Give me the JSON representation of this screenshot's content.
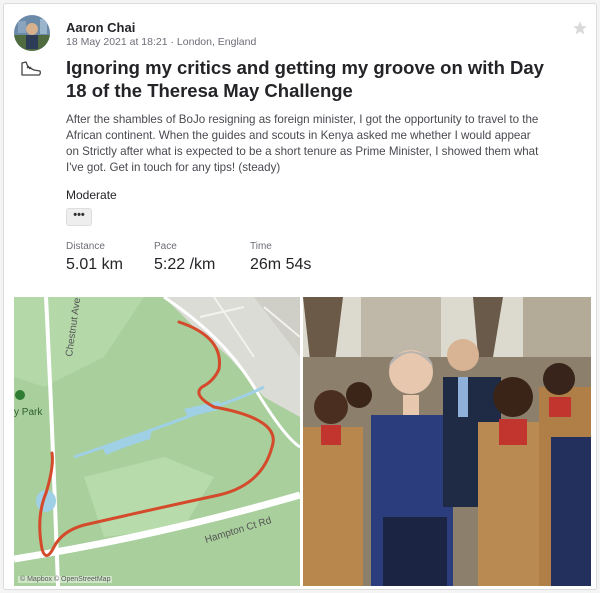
{
  "activity": {
    "athlete_name": "Aaron Chai",
    "date": "18 May 2021 at 18:21",
    "location": "London, England",
    "separator": " · ",
    "sport_icon": "running-shoe-icon",
    "title": "Ignoring my critics and getting my groove on with Day 18 of the Theresa May Challenge",
    "description": "After the shambles of BoJo resigning as foreign minister, I got the opportunity to travel to the African continent. When the guides and scouts in Kenya asked me whether I would appear on Strictly after what is expected to be a short tenure as Prime Minister, I showed them what I've got. Get in touch for any tips! (steady)",
    "effort": "Moderate",
    "more_label": "•••",
    "stats": [
      {
        "label": "Distance",
        "value": "5.01 km"
      },
      {
        "label": "Pace",
        "value": "5:22 /km"
      },
      {
        "label": "Time",
        "value": "26m 54s"
      }
    ]
  },
  "map": {
    "road_labels": [
      "Chestnut Ave",
      "Hampton Ct Rd"
    ],
    "park_label": "y Park",
    "attribution": "© Mapbox © OpenStreetMap",
    "colors": {
      "grass": "#a8cf9c",
      "water": "#9fd0e6",
      "route": "#d44a2b",
      "road": "#ffffff"
    }
  },
  "photo": {
    "alt": "Photo of Theresa May dancing with scouts in Kenya"
  },
  "colors": {
    "accent": "#fc5200",
    "text": "#242428",
    "muted": "#6d6d78"
  }
}
